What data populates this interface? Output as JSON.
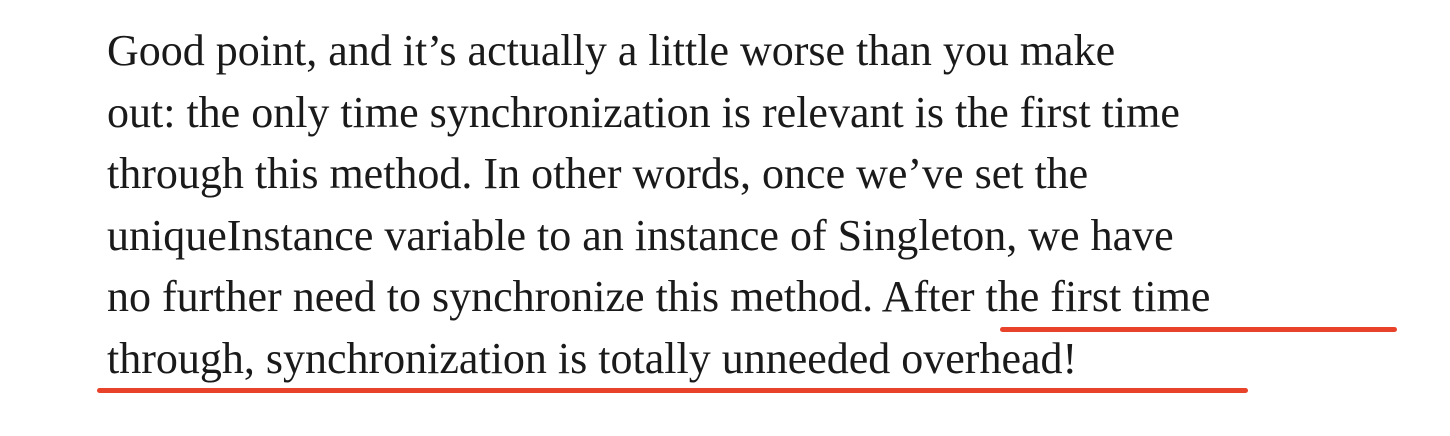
{
  "paragraph": {
    "lines": [
      "Good point, and it’s actually a little worse than you make",
      "out: the only time synchronization is relevant is the first time",
      "through this method. In other words, once we’ve set the",
      "uniqueInstance variable to an instance of Singleton, we have",
      "no further need to synchronize this method. After the first time",
      "through, synchronization is totally unneeded overhead!"
    ]
  },
  "highlight": {
    "underline_color": "#e8432a",
    "underlined_text": "After the first time through, synchronization is totally unneeded overhead!"
  }
}
